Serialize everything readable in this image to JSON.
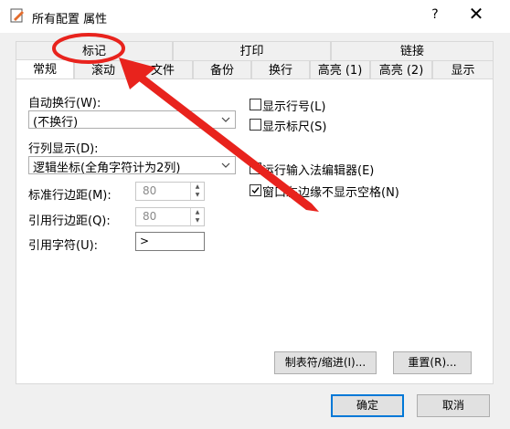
{
  "window": {
    "title": "所有配置 属性",
    "help": "?",
    "close": "✕"
  },
  "tabs_top": [
    "标记",
    "打印",
    "链接"
  ],
  "tabs_bottom": [
    "常规",
    "滚动",
    "文件",
    "备份",
    "换行",
    "高亮 (1)",
    "高亮 (2)",
    "显示"
  ],
  "active_tab": "常规",
  "general": {
    "autowrap_label": "自动换行(W):",
    "autowrap_value": "(不换行)",
    "column_label": "行列显示(D):",
    "column_value": "逻辑坐标(全角字符计为2列)",
    "std_margin_label": "标准行边距(M):",
    "std_margin_value": "80",
    "quote_margin_label": "引用行边距(Q):",
    "quote_margin_value": "80",
    "quote_char_label": "引用字符(U):",
    "quote_char_value": ">"
  },
  "checks": [
    {
      "label": "显示行号(L)",
      "checked": false
    },
    {
      "label": "显示标尺(S)",
      "checked": false
    },
    {
      "label": "运行输入法编辑器(E)",
      "checked": false
    },
    {
      "label": "窗口左边缘不显示空格(N)",
      "checked": true
    }
  ],
  "buttons": {
    "tabs_indent": "制表符/缩进(I)...",
    "reset": "重置(R)...",
    "ok": "确定",
    "cancel": "取消"
  },
  "colors": {
    "annotation": "#e8231d",
    "accent": "#0078d7"
  }
}
